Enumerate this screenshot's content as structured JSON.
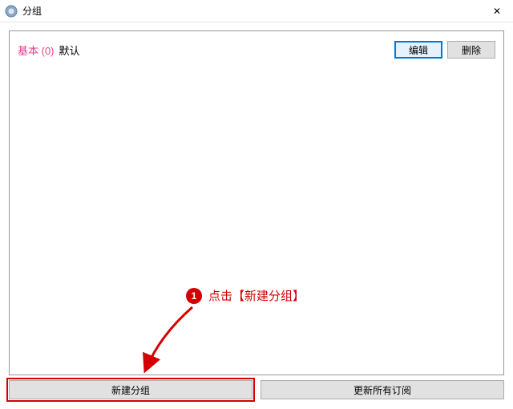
{
  "window": {
    "title": "分组",
    "close_glyph": "✕"
  },
  "group_row": {
    "name": "基本 (0)",
    "default_label": "默认",
    "edit_label": "编辑",
    "delete_label": "删除"
  },
  "bottom": {
    "new_group_label": "新建分组",
    "update_all_label": "更新所有订阅"
  },
  "annotation": {
    "step_number": "1",
    "text": "点击【新建分组】"
  }
}
